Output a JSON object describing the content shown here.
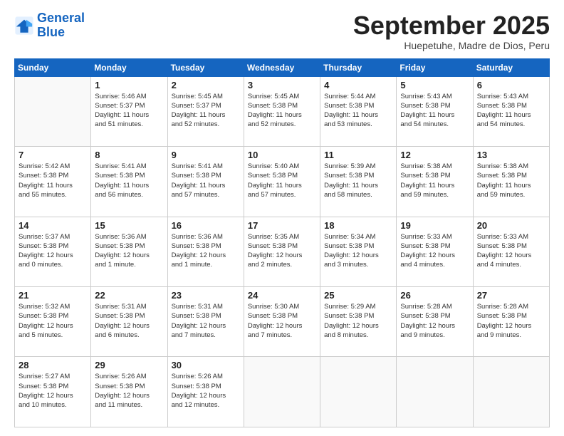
{
  "logo": {
    "line1": "General",
    "line2": "Blue"
  },
  "title": "September 2025",
  "subtitle": "Huepetuhe, Madre de Dios, Peru",
  "days_header": [
    "Sunday",
    "Monday",
    "Tuesday",
    "Wednesday",
    "Thursday",
    "Friday",
    "Saturday"
  ],
  "weeks": [
    [
      {
        "day": "",
        "info": ""
      },
      {
        "day": "1",
        "info": "Sunrise: 5:46 AM\nSunset: 5:37 PM\nDaylight: 11 hours\nand 51 minutes."
      },
      {
        "day": "2",
        "info": "Sunrise: 5:45 AM\nSunset: 5:37 PM\nDaylight: 11 hours\nand 52 minutes."
      },
      {
        "day": "3",
        "info": "Sunrise: 5:45 AM\nSunset: 5:38 PM\nDaylight: 11 hours\nand 52 minutes."
      },
      {
        "day": "4",
        "info": "Sunrise: 5:44 AM\nSunset: 5:38 PM\nDaylight: 11 hours\nand 53 minutes."
      },
      {
        "day": "5",
        "info": "Sunrise: 5:43 AM\nSunset: 5:38 PM\nDaylight: 11 hours\nand 54 minutes."
      },
      {
        "day": "6",
        "info": "Sunrise: 5:43 AM\nSunset: 5:38 PM\nDaylight: 11 hours\nand 54 minutes."
      }
    ],
    [
      {
        "day": "7",
        "info": "Sunrise: 5:42 AM\nSunset: 5:38 PM\nDaylight: 11 hours\nand 55 minutes."
      },
      {
        "day": "8",
        "info": "Sunrise: 5:41 AM\nSunset: 5:38 PM\nDaylight: 11 hours\nand 56 minutes."
      },
      {
        "day": "9",
        "info": "Sunrise: 5:41 AM\nSunset: 5:38 PM\nDaylight: 11 hours\nand 57 minutes."
      },
      {
        "day": "10",
        "info": "Sunrise: 5:40 AM\nSunset: 5:38 PM\nDaylight: 11 hours\nand 57 minutes."
      },
      {
        "day": "11",
        "info": "Sunrise: 5:39 AM\nSunset: 5:38 PM\nDaylight: 11 hours\nand 58 minutes."
      },
      {
        "day": "12",
        "info": "Sunrise: 5:38 AM\nSunset: 5:38 PM\nDaylight: 11 hours\nand 59 minutes."
      },
      {
        "day": "13",
        "info": "Sunrise: 5:38 AM\nSunset: 5:38 PM\nDaylight: 11 hours\nand 59 minutes."
      }
    ],
    [
      {
        "day": "14",
        "info": "Sunrise: 5:37 AM\nSunset: 5:38 PM\nDaylight: 12 hours\nand 0 minutes."
      },
      {
        "day": "15",
        "info": "Sunrise: 5:36 AM\nSunset: 5:38 PM\nDaylight: 12 hours\nand 1 minute."
      },
      {
        "day": "16",
        "info": "Sunrise: 5:36 AM\nSunset: 5:38 PM\nDaylight: 12 hours\nand 1 minute."
      },
      {
        "day": "17",
        "info": "Sunrise: 5:35 AM\nSunset: 5:38 PM\nDaylight: 12 hours\nand 2 minutes."
      },
      {
        "day": "18",
        "info": "Sunrise: 5:34 AM\nSunset: 5:38 PM\nDaylight: 12 hours\nand 3 minutes."
      },
      {
        "day": "19",
        "info": "Sunrise: 5:33 AM\nSunset: 5:38 PM\nDaylight: 12 hours\nand 4 minutes."
      },
      {
        "day": "20",
        "info": "Sunrise: 5:33 AM\nSunset: 5:38 PM\nDaylight: 12 hours\nand 4 minutes."
      }
    ],
    [
      {
        "day": "21",
        "info": "Sunrise: 5:32 AM\nSunset: 5:38 PM\nDaylight: 12 hours\nand 5 minutes."
      },
      {
        "day": "22",
        "info": "Sunrise: 5:31 AM\nSunset: 5:38 PM\nDaylight: 12 hours\nand 6 minutes."
      },
      {
        "day": "23",
        "info": "Sunrise: 5:31 AM\nSunset: 5:38 PM\nDaylight: 12 hours\nand 7 minutes."
      },
      {
        "day": "24",
        "info": "Sunrise: 5:30 AM\nSunset: 5:38 PM\nDaylight: 12 hours\nand 7 minutes."
      },
      {
        "day": "25",
        "info": "Sunrise: 5:29 AM\nSunset: 5:38 PM\nDaylight: 12 hours\nand 8 minutes."
      },
      {
        "day": "26",
        "info": "Sunrise: 5:28 AM\nSunset: 5:38 PM\nDaylight: 12 hours\nand 9 minutes."
      },
      {
        "day": "27",
        "info": "Sunrise: 5:28 AM\nSunset: 5:38 PM\nDaylight: 12 hours\nand 9 minutes."
      }
    ],
    [
      {
        "day": "28",
        "info": "Sunrise: 5:27 AM\nSunset: 5:38 PM\nDaylight: 12 hours\nand 10 minutes."
      },
      {
        "day": "29",
        "info": "Sunrise: 5:26 AM\nSunset: 5:38 PM\nDaylight: 12 hours\nand 11 minutes."
      },
      {
        "day": "30",
        "info": "Sunrise: 5:26 AM\nSunset: 5:38 PM\nDaylight: 12 hours\nand 12 minutes."
      },
      {
        "day": "",
        "info": ""
      },
      {
        "day": "",
        "info": ""
      },
      {
        "day": "",
        "info": ""
      },
      {
        "day": "",
        "info": ""
      }
    ]
  ]
}
